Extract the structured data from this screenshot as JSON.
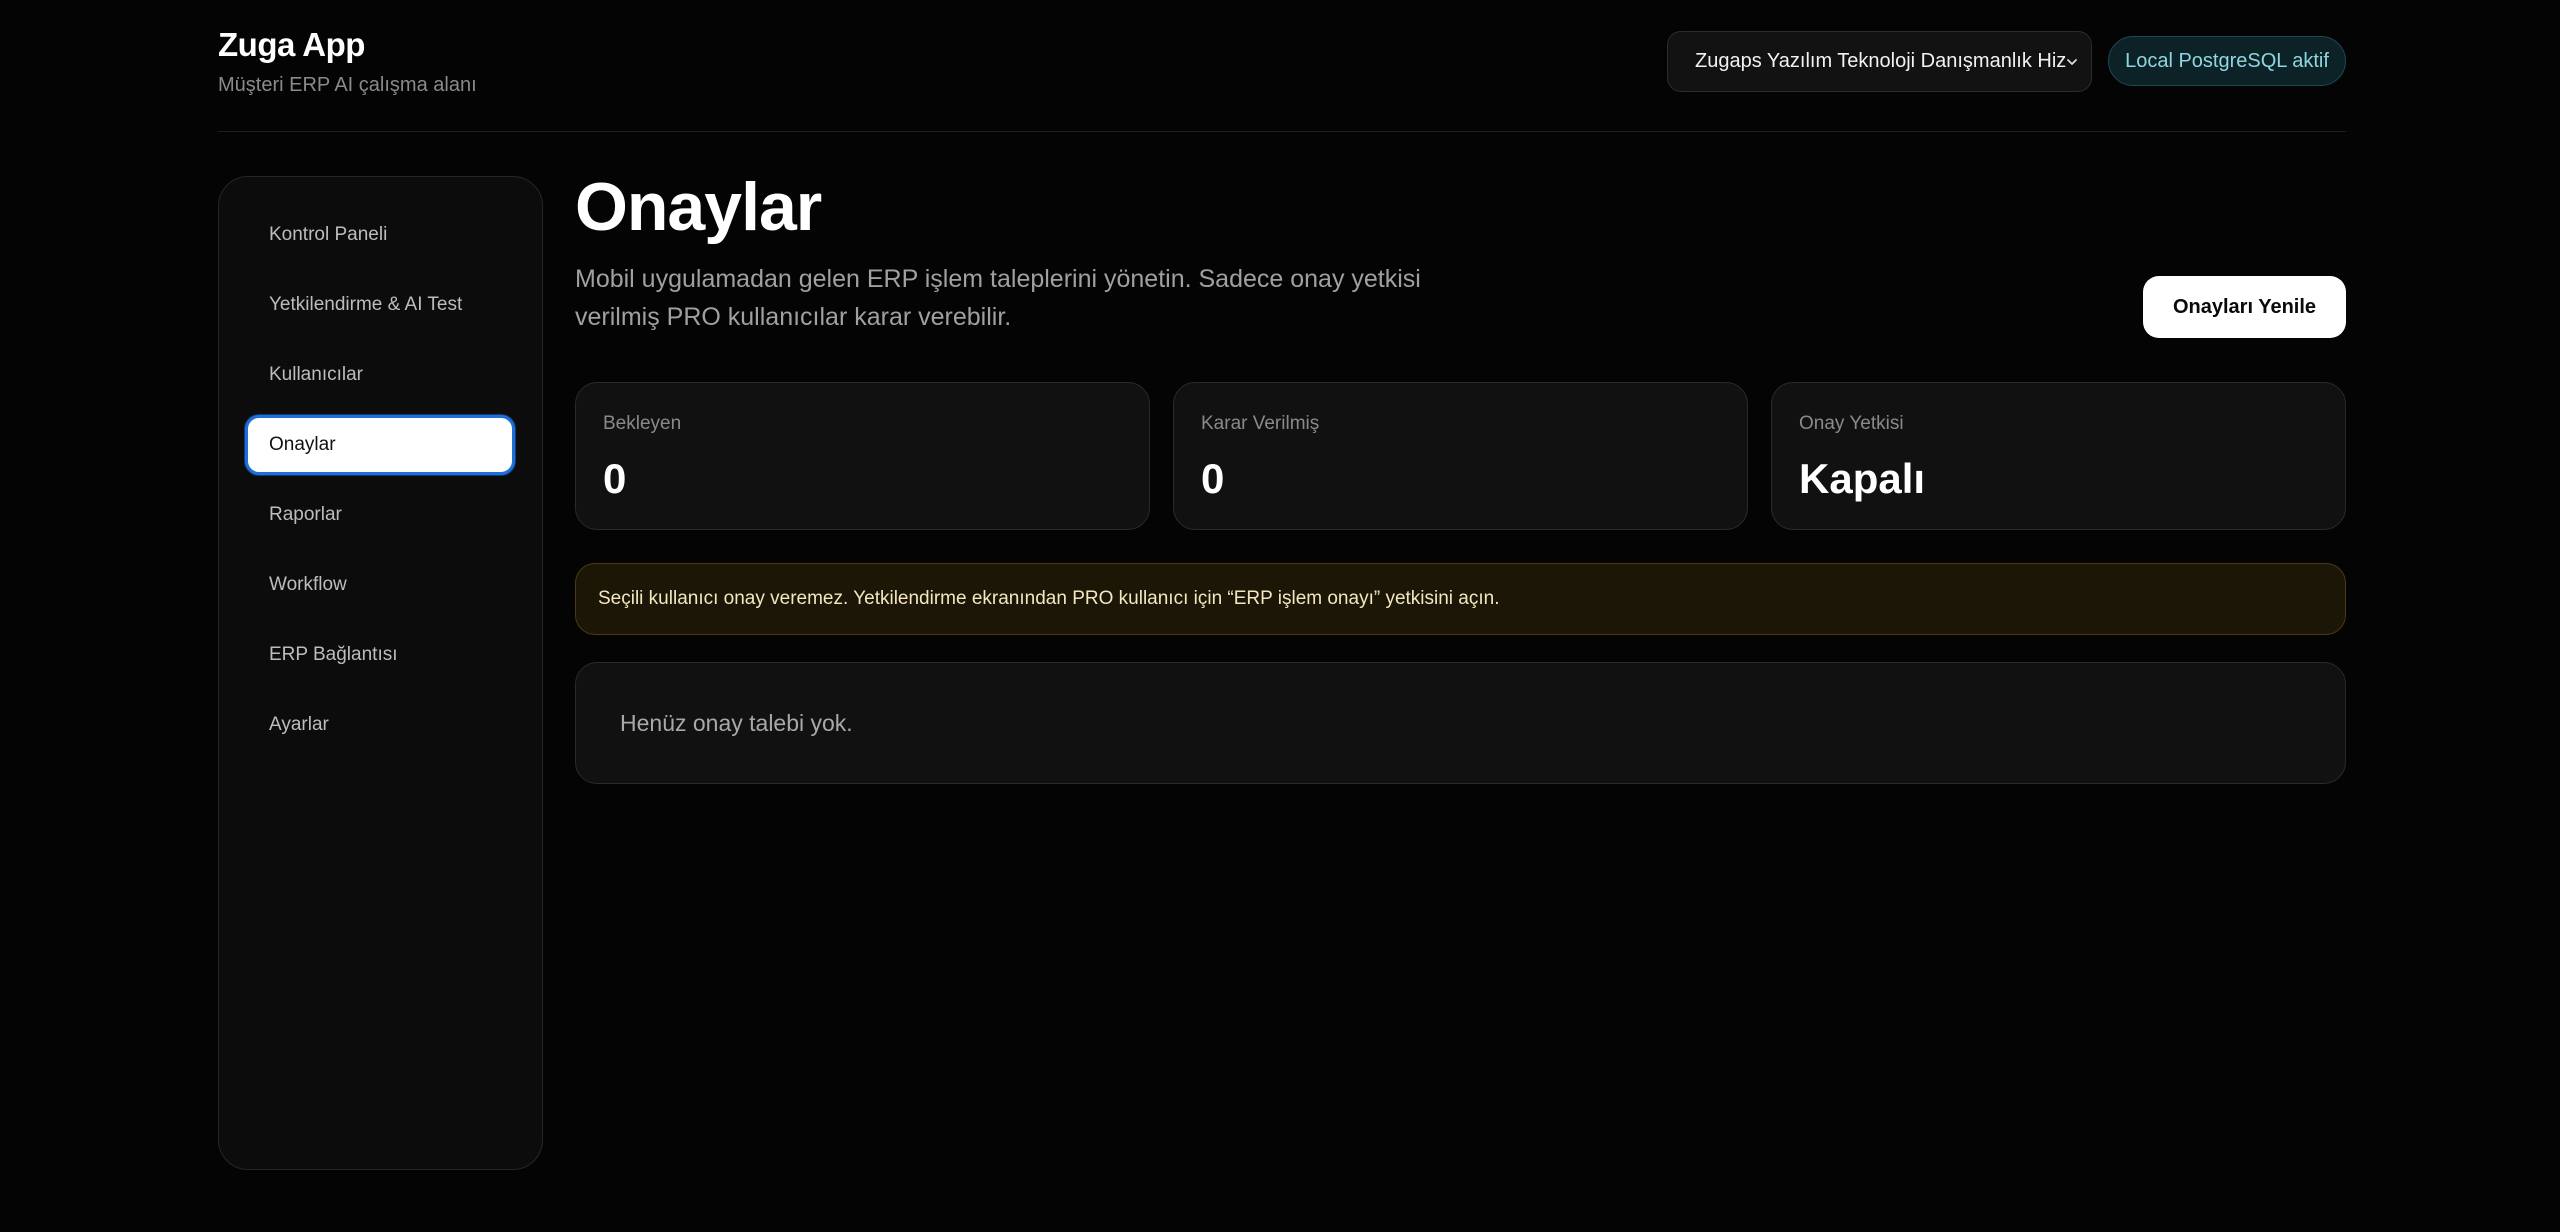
{
  "app": {
    "title": "Zuga App",
    "subtitle": "Müşteri ERP AI çalışma alanı"
  },
  "header": {
    "company_select_value": "Zugaps Yazılım Teknoloji Danışmanlık Hiz",
    "db_status": "Local PostgreSQL aktif",
    "db_status_color": "#8fd6e0"
  },
  "sidebar": {
    "items": [
      {
        "label": "Kontrol Paneli",
        "active": false
      },
      {
        "label": "Yetkilendirme & AI Test",
        "active": false
      },
      {
        "label": "Kullanıcılar",
        "active": false
      },
      {
        "label": "Onaylar",
        "active": true
      },
      {
        "label": "Raporlar",
        "active": false
      },
      {
        "label": "Workflow",
        "active": false
      },
      {
        "label": "ERP Bağlantısı",
        "active": false
      },
      {
        "label": "Ayarlar",
        "active": false
      }
    ]
  },
  "main": {
    "title": "Onaylar",
    "description": "Mobil uygulamadan gelen ERP işlem taleplerini yönetin. Sadece onay yetkisi verilmiş PRO kullanıcılar karar verebilir.",
    "refresh_button": "Onayları Yenile",
    "stats": [
      {
        "label": "Bekleyen",
        "value": "0"
      },
      {
        "label": "Karar Verilmiş",
        "value": "0"
      },
      {
        "label": "Onay Yetkisi",
        "value": "Kapalı"
      }
    ],
    "warning": "Seçili kullanıcı onay veremez. Yetkilendirme ekranından PRO kullanıcı için “ERP işlem onayı” yetkisini açın.",
    "empty_state": "Henüz onay talebi yok."
  },
  "colors": {
    "background": "#040404",
    "active_outline": "#1f6fd6",
    "warning_bg": "#1c1606"
  }
}
